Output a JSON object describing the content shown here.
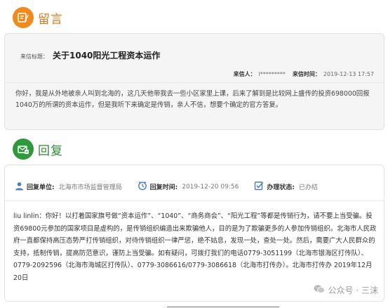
{
  "letter_section": {
    "heading": "留言",
    "label_title": "来信标题：",
    "title": "关于1040阳光工程资本运作",
    "sender_label": "来信人：",
    "sender": "l*********",
    "date_label": "来信时间：",
    "date": "2019-12-13 17:57",
    "body": "你好，我是从外地被亲人叫到北海的，这几天他带我去一些小区家里上课，后来了解到是比较网上盛传的投资698000回报1040万的所谓的资本运作，但是我听下来确定是传销，亲人不信，想要个确定的官方答复。"
  },
  "reply_section": {
    "heading": "回复",
    "unit_label": "回复单位:",
    "unit": "北海市市场监督管理局",
    "time_label": "回复时间:",
    "time": "2019-12-20 09:56",
    "status_label": "办理状态:",
    "status": "已办结",
    "body": "liu linlin：你好！以打着国家旗号做“资本运作”、“1040”、“商务商会”、“阳光工程”等都是传销行为，请不要上当受骗。投资69800元参加的国家项目是虚构的，是传销组织编造出来欺骗他人，目的是为了欺骗更多的人参加传销组织。北海市人民政府一直都保持高压态势严打传销组织，对待传销组织一律严惩，绝不姑息，发现一处，查处一处。然后，需要广大人民群众的支持，抵制传销，提高防范意识，谨防上当受骗。如有疑问，可拨打我们的电话0779-3051199（北海市银海区打传队）、0779-2092596（北海市海城区打传队）、0779-3086616/0779-3086618（北海市打传办）。北海市打传办 2019年12月20日"
  },
  "watermark": "公众号 · 三沫",
  "colors": {
    "orange": "#f08a1c",
    "green": "#2f9a3c",
    "link_blue": "#4a7fc1"
  },
  "icons": [
    "message-edit-icon",
    "reply-mail-icon",
    "user-icon",
    "clock-icon",
    "check-square-icon",
    "wechat-icon"
  ]
}
